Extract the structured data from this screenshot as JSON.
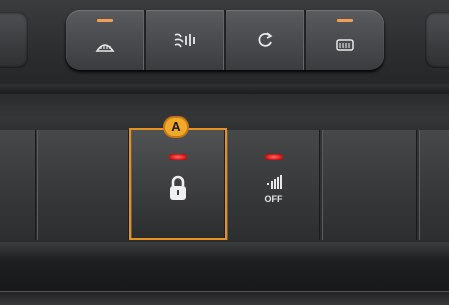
{
  "callout": {
    "label": "A"
  },
  "climate_buttons": [
    {
      "id": "front-defrost",
      "icon": "front-defrost-icon",
      "glyph": "❖",
      "led": "#f0a050"
    },
    {
      "id": "air-flow",
      "icon": "air-flow-icon",
      "glyph": "⌁",
      "led": null
    },
    {
      "id": "recirculation",
      "icon": "recirculation-icon",
      "glyph": "↻",
      "led": null
    },
    {
      "id": "rear-defrost",
      "icon": "rear-defrost-icon",
      "glyph": "▭",
      "led": "#f0a050"
    }
  ],
  "lock_button": {
    "icon": "padlock-icon",
    "led_color": "#e01818"
  },
  "alarm_button": {
    "icon": "signal-off-icon",
    "label": "OFF",
    "led_color": "#e01818"
  },
  "colors": {
    "highlight": "#e8921e",
    "badge": "#f2a82b"
  }
}
